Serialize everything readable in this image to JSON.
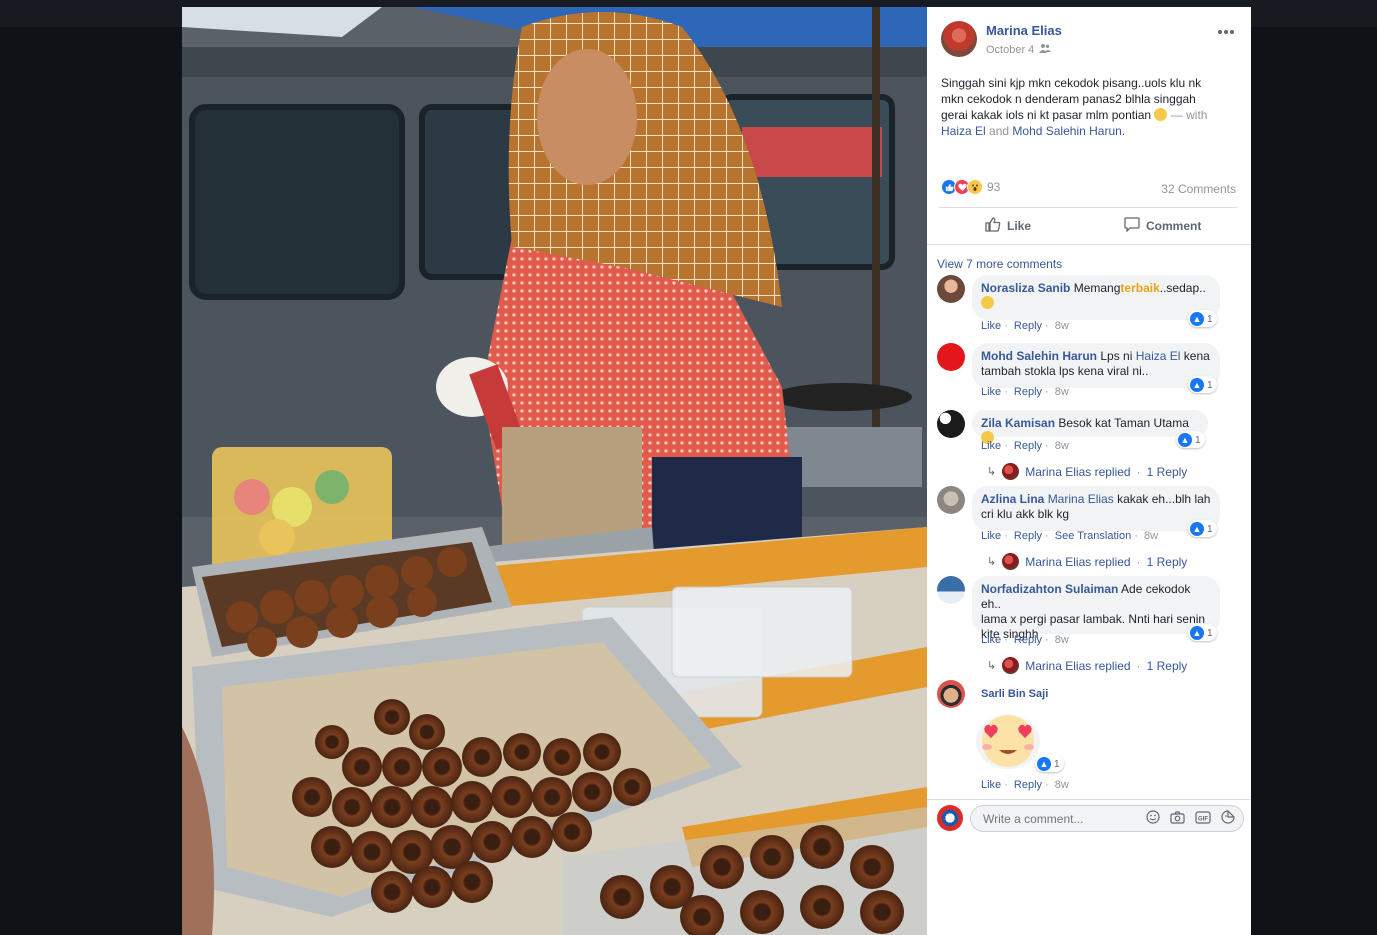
{
  "post": {
    "author": "Marina Elias",
    "date": "October 4",
    "more_icon": "ellipsis-icon",
    "privacy_icon": "friends-icon",
    "text_lines": [
      "Singgah sini kjp mkn cekodok pisang..uols klu nk",
      "mkn cekodok n denderam panas2 blhla singgah",
      "gerai kakak iols ni kt pasar mlm pontian"
    ],
    "with_text": "— with",
    "tagged_1": "Haiza El",
    "and_text": "and",
    "tagged_2": "Mohd Salehin Harun."
  },
  "reactions": {
    "count": "93",
    "comments_count": "32 Comments",
    "icons": [
      "like-icon",
      "love-icon",
      "wow-icon"
    ]
  },
  "buttons": {
    "like_label": "Like",
    "comment_label": "Comment"
  },
  "comments": {
    "view_more": "View 7 more comments",
    "items": [
      {
        "name": "Norasliza Sanib",
        "text_a": "Memang",
        "highlight": "terbaik",
        "text_b": "..sedap..",
        "likes": "1",
        "time": "8w"
      },
      {
        "name": "Mohd Salehin Harun",
        "text_a": "Lps ni",
        "mention": "Haiza El",
        "text_b": "kena",
        "line2": "tambah stokla lps kena viral ni..",
        "likes": "1",
        "time": "8w"
      },
      {
        "name": "Zila Kamisan",
        "text": "Besok kat Taman Utama",
        "likes": "1",
        "time": "8w",
        "replied_by": "Marina Elias replied",
        "reply_count": "1 Reply"
      },
      {
        "name": "Azlina Lina",
        "mention": "Marina Elias",
        "text_b": "kakak eh...blh lah",
        "line2": "cri klu akk blk kg",
        "likes": "1",
        "see_translation": "See Translation",
        "time": "8w",
        "replied_by": "Marina Elias replied",
        "reply_count": "1 Reply"
      },
      {
        "name": "Norfadizahton Sulaiman",
        "text": "Ade cekodok eh..",
        "line2": "lama x pergi pasar lambak. Nnti hari senin",
        "line3": "kite singhh",
        "likes": "1",
        "time": "8w",
        "replied_by": "Marina Elias replied",
        "reply_count": "1 Reply"
      },
      {
        "name": "Sarli Bin Saji",
        "likes": "1",
        "time": "8w"
      }
    ],
    "like_action": "Like",
    "reply_action": "Reply"
  },
  "composer": {
    "placeholder": "Write a comment...",
    "icons": [
      "emoji-icon",
      "camera-icon",
      "gif-icon",
      "sticker-icon"
    ]
  },
  "colors": {
    "link": "#385898",
    "facebook_blue": "#1877f2",
    "bubble": "#f2f3f5",
    "highlight": "#e8a317"
  }
}
